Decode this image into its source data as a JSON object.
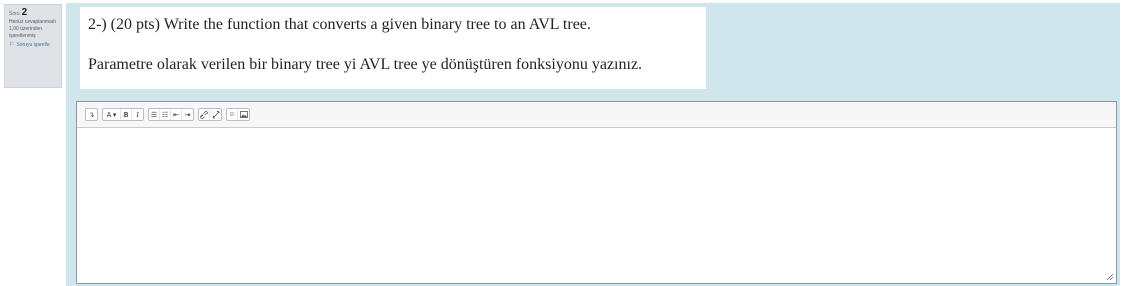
{
  "question_info": {
    "question_word": "Soru",
    "question_number": "2",
    "status": "Henüz cevaplanmadı",
    "marks": "1,00 üzerinden işaretlenmiş",
    "flag_label": "Soruyu işaretle"
  },
  "question": {
    "text_en": "2-) (20 pts) Write the function that converts a given binary tree  to an AVL tree.",
    "text_tr": "Parametre olarak verilen bir binary tree yi AVL tree ye dönüştüren fonksiyonu yazınız."
  },
  "editor": {
    "toolbar": {
      "collapse": "↴",
      "font_style": "A ▾",
      "bold": "B",
      "italic": "I",
      "unordered_list": "☰",
      "ordered_list": "☷",
      "outdent": "⇤",
      "indent": "⇥",
      "link": "🔗",
      "unlink": "⛓",
      "emoticon": "☺",
      "image": "▣"
    },
    "value": ""
  }
}
